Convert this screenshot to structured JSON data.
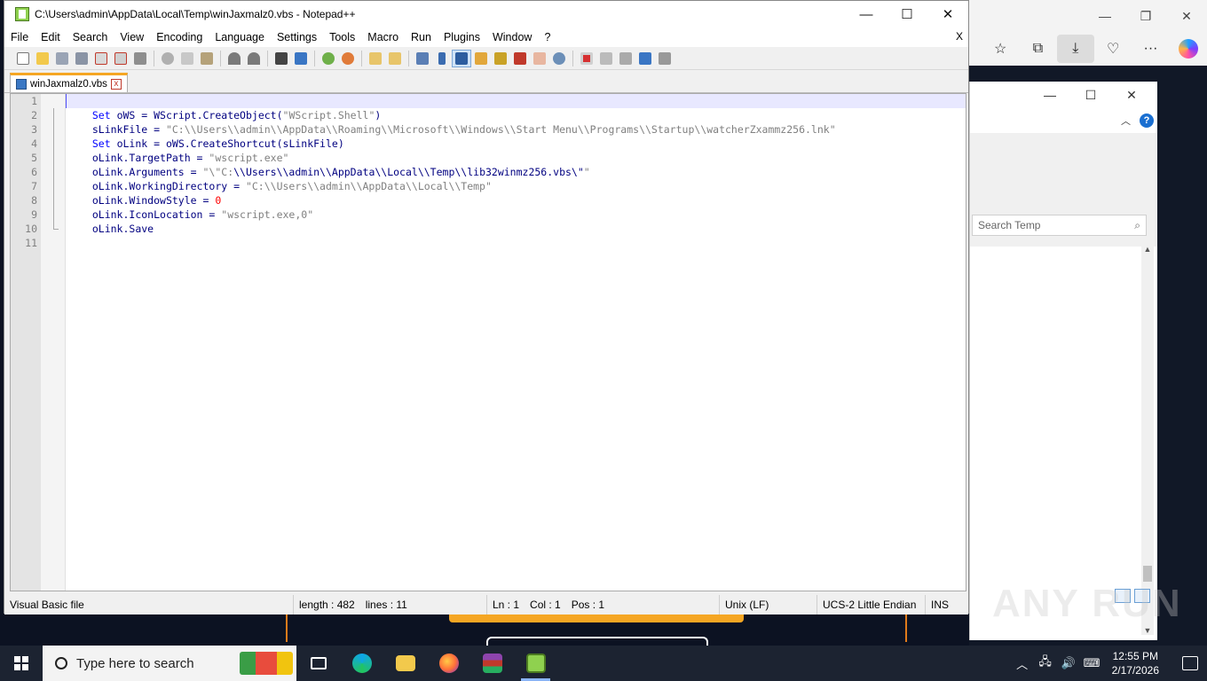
{
  "window": {
    "title": "C:\\Users\\admin\\AppData\\Local\\Temp\\winJaxmalz0.vbs - Notepad++",
    "minimize": "—",
    "maximize": "☐",
    "close": "✕",
    "menu_close": "X"
  },
  "menu": [
    "File",
    "Edit",
    "Search",
    "View",
    "Encoding",
    "Language",
    "Settings",
    "Tools",
    "Macro",
    "Run",
    "Plugins",
    "Window",
    "?"
  ],
  "toolbar_icons": [
    "new-file-icon",
    "open-file-icon",
    "save-icon",
    "save-all-icon",
    "close-icon",
    "close-all-icon",
    "print-icon",
    "cut-icon",
    "copy-icon",
    "paste-icon",
    "undo-icon",
    "redo-icon",
    "find-icon",
    "replace-icon",
    "zoom-in-icon",
    "zoom-out-icon",
    "sync-vertical-icon",
    "sync-horizontal-icon",
    "word-wrap-icon",
    "show-all-chars-icon",
    "indent-guide-icon",
    "udl-icon",
    "doc-map-icon",
    "function-list-icon",
    "folder-workspace-icon",
    "monitoring-icon",
    "record-macro-icon",
    "stop-macro-icon",
    "play-macro-icon",
    "run-macro-multiple-icon",
    "save-macro-icon"
  ],
  "tab": {
    "label": "winJaxmalz0.vbs",
    "close": "x"
  },
  "code": {
    "line_numbers": [
      "1",
      "2",
      "3",
      "4",
      "5",
      "6",
      "7",
      "8",
      "9",
      "10",
      "11"
    ]
  },
  "status": {
    "file_type": "Visual Basic file",
    "length": "length : 482",
    "lines": "lines : 11",
    "ln": "Ln : 1",
    "col": "Col : 1",
    "pos": "Pos : 1",
    "eol": "Unix (LF)",
    "encoding": "UCS-2 Little Endian",
    "mode": "INS"
  },
  "explorer": {
    "search_placeholder": "Search Temp",
    "minimize": "—",
    "maximize": "☐",
    "close": "✕",
    "help": "?"
  },
  "browser": {
    "minimize": "—",
    "maximize": "❐",
    "close": "✕",
    "more": "···"
  },
  "taskbar": {
    "search_placeholder": "Type here to search",
    "time": "12:55 PM",
    "date": "2/17/2026"
  },
  "watermark": "ANY RUN",
  "colors": {
    "keyword": "#0000ff",
    "string": "#808080",
    "number": "#ff0000",
    "tab_accent": "#f5a623"
  }
}
